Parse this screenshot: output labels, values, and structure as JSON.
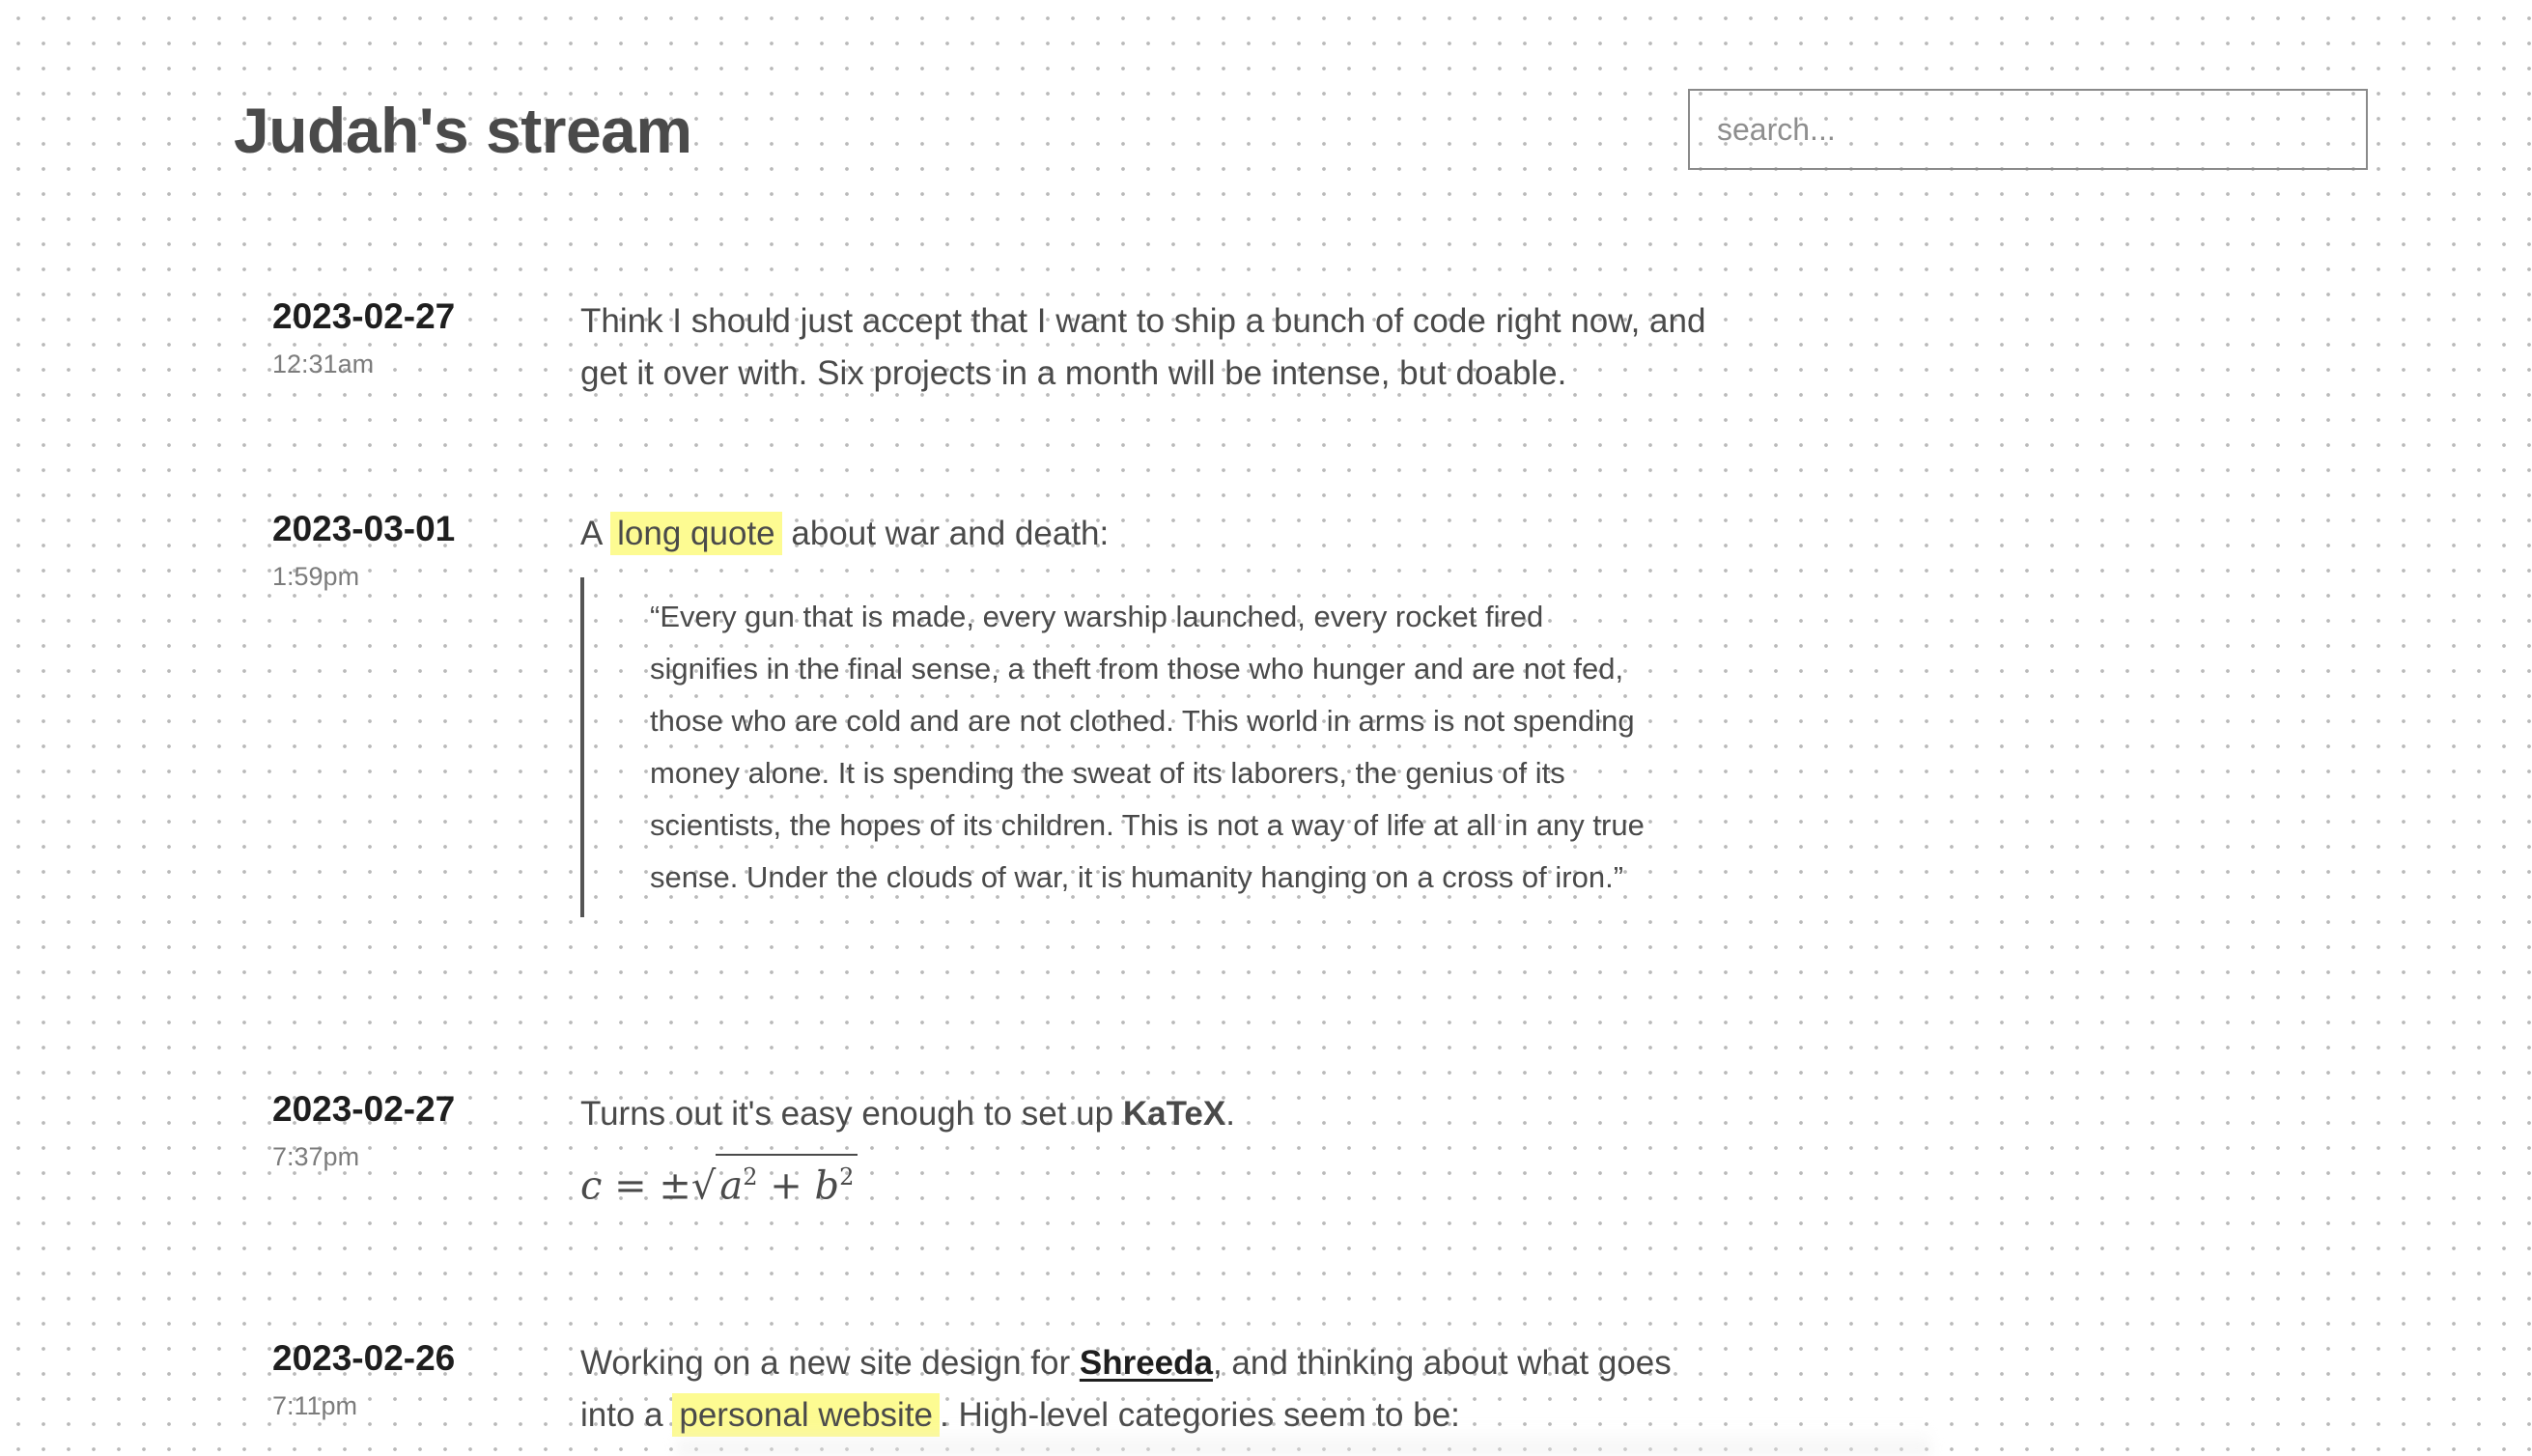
{
  "site": {
    "title": "Judah's stream"
  },
  "search": {
    "placeholder": "search..."
  },
  "colors": {
    "highlight": "#fdfb92",
    "text": "#4a4a4a",
    "date": "#1e1e1e",
    "time": "#7c7c7c"
  },
  "entries": [
    {
      "date": "2023-02-27",
      "time": "12:31am",
      "text": "Think I should just accept that I want to ship a bunch of code right now, and get it over with. Six projects in a month will be intense, but doable."
    },
    {
      "date": "2023-03-01",
      "time": "1:59pm",
      "text_before": "A",
      "link": "long quote",
      "text_after": "about war and death:",
      "quote": "“Every gun that is made, every warship launched, every rocket fired signifies in the final sense, a theft from those who hunger and are not fed, those who are cold and are not clothed. This world in arms is not spending money alone. It is spending the sweat of its laborers, the genius of its scientists, the hopes of its children. This is not a way of life at all in any true sense. Under the clouds of war, it is humanity hanging on a cross of iron.”"
    },
    {
      "date": "2023-02-27",
      "time": "7:37pm",
      "text_before": "Turns out it's easy enough to set up",
      "strong": "KaTeX",
      "text_after": ".",
      "math": {
        "c": "c",
        "eq": "=",
        "pm": "±",
        "radical": "√",
        "a": "a",
        "a_exp": "2",
        "plus": "+",
        "b": "b",
        "b_exp": "2"
      }
    },
    {
      "date": "2023-02-26",
      "time": "7:11pm",
      "text_before": "Working on a new site design for",
      "link1": "Shreeda",
      "text_middle": ", and thinking about what goes into a",
      "link2": "personal website",
      "text_after": ". High-level categories seem to be:"
    }
  ]
}
